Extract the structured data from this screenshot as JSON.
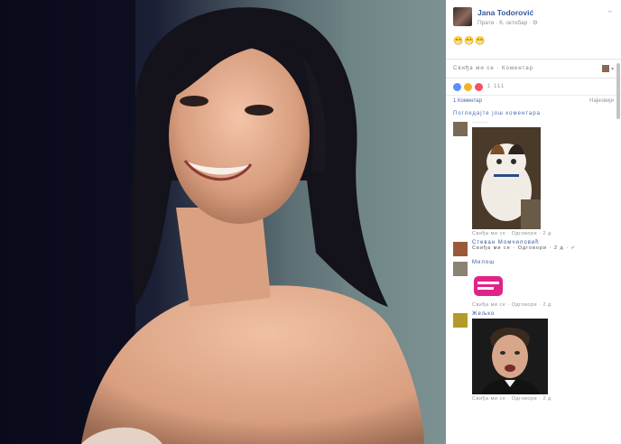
{
  "post": {
    "author": "Jana Todorović",
    "meta": "Прати · 6. октобар · ⚙",
    "options": "⌄",
    "text": "😁😁😁"
  },
  "actions": {
    "like": "Свиђа ми се · Коментар",
    "share_arrow": "▾"
  },
  "reactions": {
    "count": "1 111"
  },
  "comments_sort": {
    "left": "1 Коментар",
    "right": "Најновији"
  },
  "view_more": "Погледајте још коментара",
  "comments": [
    {
      "name": "······",
      "meta": "Свиђа ми се · Одговори · 2 д"
    },
    {
      "name": "Стеван Момчиловић",
      "text": "Свиђа ми се · Одговори · 2 д · ✓"
    },
    {
      "name": "Милош",
      "meta": "Свиђа ми се · Одговори · 2 д"
    },
    {
      "name": "Жељко",
      "meta": "Свиђа ми се · Одговори · 2 д"
    }
  ],
  "colors": {
    "fb_blue": "#365899",
    "link_blue": "#4267b2",
    "meta_gray": "#90949c"
  }
}
